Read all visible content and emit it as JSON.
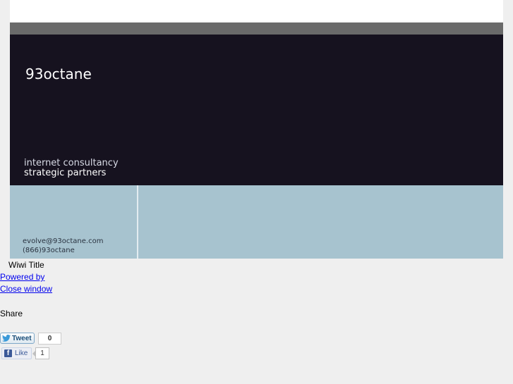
{
  "banner": {
    "brand": "93octane",
    "tagline_line1": "internet consultancy",
    "tagline_line2": "strategic partners",
    "email": "evolve@93octane.com",
    "phone": "(866)93octane",
    "colors": {
      "dark": "#16121f",
      "gray": "#6a6a6a",
      "blue": "#a7c3cf"
    }
  },
  "content": {
    "title": "Wiwi Title",
    "powered_by": "Powered by",
    "close_window": "Close window",
    "share_label": "Share"
  },
  "social": {
    "tweet_label": "Tweet",
    "tweet_count": "0",
    "like_label": "Like",
    "like_count": "1",
    "icons": [
      "twitter-bird-icon",
      "facebook-f-icon"
    ]
  }
}
